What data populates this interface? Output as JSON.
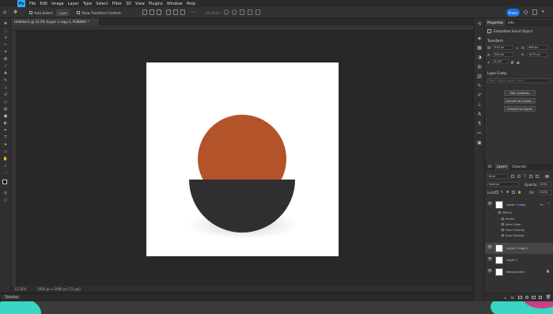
{
  "app": {
    "logo_text": "Ps"
  },
  "menubar": {
    "items": [
      "File",
      "Edit",
      "Image",
      "Layer",
      "Type",
      "Select",
      "Filter",
      "3D",
      "View",
      "Plugins",
      "Window",
      "Help"
    ]
  },
  "options": {
    "auto_select_label": "Auto-Select",
    "target_value": "Layer",
    "transform_label": "Show Transform Controls",
    "mode_3d": "3D Mode:",
    "share_label": "Share"
  },
  "document": {
    "tab_title": "Untitled-1 @ 33.3% (Layer 1 copy 2, RGB/8#) *"
  },
  "status": {
    "zoom": "33.33%",
    "info": "2000 px x 2000 px (72 ppi)"
  },
  "timeline": {
    "label": "Timeline"
  },
  "properties": {
    "tabs": [
      "Properties",
      "Info"
    ],
    "object_type": "Embedded Smart Object",
    "transform_heading": "Transform",
    "w_label": "W:",
    "w_value": "932 px",
    "h_label": "H:",
    "h_value": "465 px",
    "x_label": "X:",
    "x_value": "540 px",
    "y_label": "Y:",
    "y_value": "1079 px",
    "angle_value": "0.00°",
    "layer_comp_heading": "Layer Comp",
    "layer_comp_placeholder": "Don't Apply Layer Comp",
    "buttons": [
      "Edit Contents",
      "Convert to Linked...",
      "Convert to Layers"
    ]
  },
  "layers": {
    "tabs": [
      "3D",
      "Layers",
      "Channels"
    ],
    "filter_label": "Kind",
    "blend_mode": "Normal",
    "opacity_label": "Opacity:",
    "opacity_value": "100%",
    "lock_label": "Lock:",
    "fill_label": "Fill:",
    "fill_value": "100%",
    "items": [
      {
        "name": "Layer 1 copy",
        "fx": "fx"
      },
      {
        "name": "Layer 1 copy 2"
      },
      {
        "name": "Layer 1"
      },
      {
        "name": "Background"
      }
    ],
    "effects_heading": "Effects",
    "effects": [
      "Stroke",
      "Inner Glow",
      "Color Overlay",
      "Drop Shadow"
    ]
  },
  "colors": {
    "accent": "#31a8ff",
    "circle": "#b2532a",
    "bowl": "#2f2f2f",
    "workarea": "#282828",
    "share": "#1473e6"
  }
}
